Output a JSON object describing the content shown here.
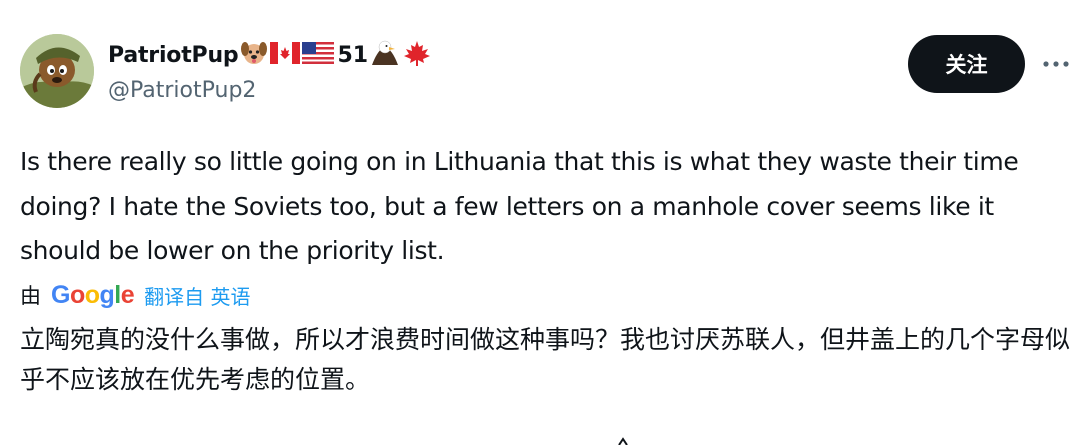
{
  "user": {
    "display_name": "PatriotPup",
    "badge_number": "51",
    "handle": "@PatriotPup2",
    "icons": [
      "dog-face-icon",
      "canada-flag-icon",
      "us-flag-icon",
      "eagle-icon",
      "maple-leaf-icon"
    ]
  },
  "actions": {
    "follow_label": "关注",
    "more_label": "···"
  },
  "tweet": {
    "text": "Is there really so little going on in Lithuania that this is what they waste their time doing? I hate the Soviets too, but a few letters on a manhole cover seems like it should be lower on the priority list."
  },
  "translation": {
    "by_label": "由",
    "provider": "Google",
    "translated_from_label": "翻译自 英语",
    "text": "立陶宛真的没什么事做，所以才浪费时间做这种事吗？我也讨厌苏联人，但井盖上的几个字母似乎不应该放在优先考虑的位置。"
  },
  "colors": {
    "follow_bg": "#0f1419",
    "link": "#1d9bf0",
    "secondary_text": "#536471"
  }
}
